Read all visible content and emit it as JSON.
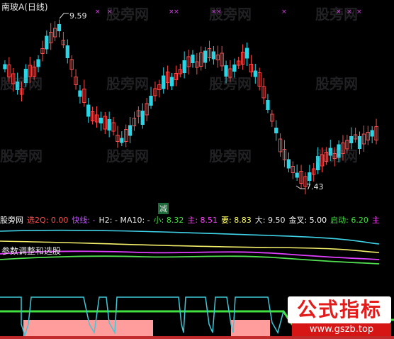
{
  "header": {
    "title": "南玻A(日线)"
  },
  "main_chart": {
    "high_label": "9.59",
    "low_label": "7.43",
    "signal_label": "减",
    "colors": {
      "up": "#ff4a4a",
      "down": "#2ad6e6",
      "marker": "#e03cf0"
    }
  },
  "indicator_bar": {
    "items": [
      {
        "text": "股旁网",
        "color": "#ffffff"
      },
      {
        "text": "选2Q: 0.00",
        "color": "#ff5050"
      },
      {
        "text": "快线: -",
        "color": "#c050ff"
      },
      {
        "text": "H2: - MA10: -",
        "color": "#e6e6e6"
      },
      {
        "text": "小: 8.32",
        "color": "#40e040"
      },
      {
        "text": "主: 8.51",
        "color": "#ff40ff"
      },
      {
        "text": "要: 8.83",
        "color": "#ffff60"
      },
      {
        "text": "大: 9.50",
        "color": "#e6e6e6"
      },
      {
        "text": "金叉: 5.00",
        "color": "#ffffff"
      },
      {
        "text": "启动: 6.20",
        "color": "#40e040"
      },
      {
        "text": "主",
        "color": "#ff40ff"
      }
    ]
  },
  "sub1": {
    "label": "参数调整和选股"
  },
  "watermark": {
    "text": "股旁网"
  },
  "stamp": {
    "title": "公式指标",
    "url": "www.gszb.top"
  }
}
